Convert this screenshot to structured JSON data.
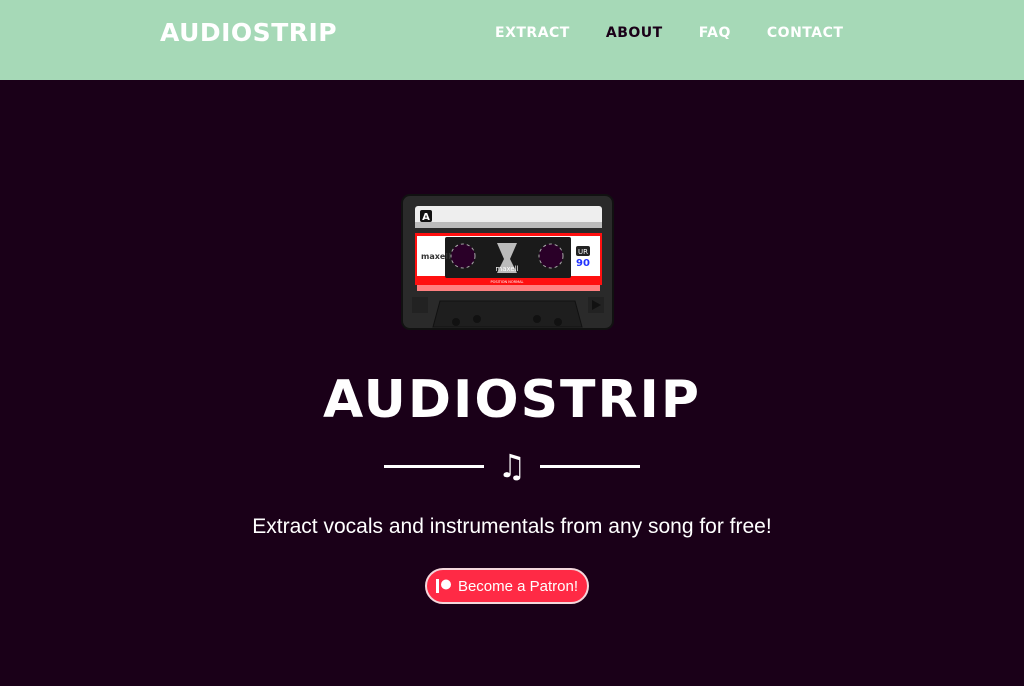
{
  "header": {
    "brand": "AUDIOSTRIP",
    "nav": [
      {
        "label": "EXTRACT"
      },
      {
        "label": "ABOUT",
        "active": true
      },
      {
        "label": "FAQ"
      },
      {
        "label": "CONTACT"
      }
    ]
  },
  "hero": {
    "cassette": {
      "side": "A",
      "brand": "maxell",
      "type": "UR",
      "length": "90",
      "position": "POSITION NORMAL"
    },
    "title": "AUDIOSTRIP",
    "divider_icon": "music-note-icon",
    "tagline": "Extract vocals and instrumentals from any song for free!",
    "patron_button": "Become a Patron!",
    "patron_icon": "patreon-icon"
  },
  "colors": {
    "header_bg": "#a6d9b7",
    "page_bg": "#1a0018",
    "patron_red": "#ff2a45"
  }
}
